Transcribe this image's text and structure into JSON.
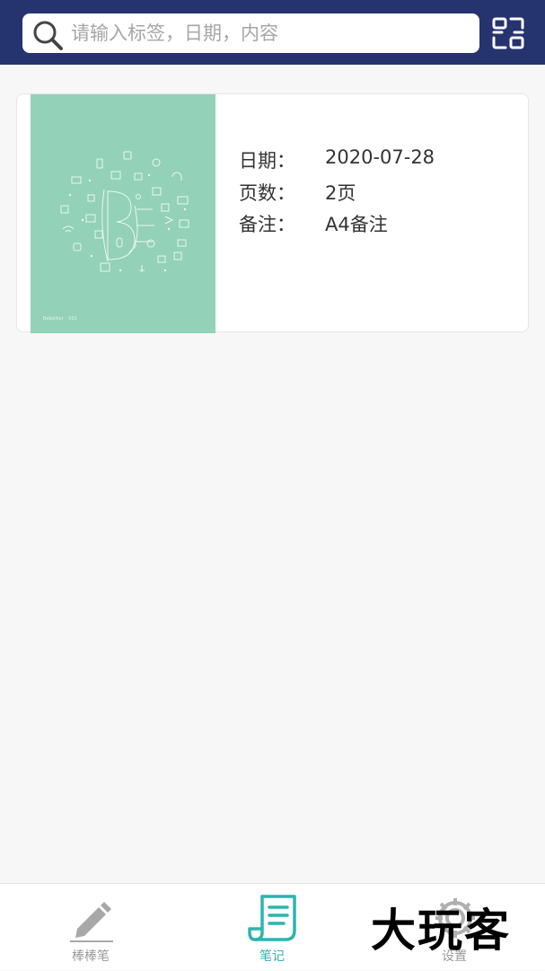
{
  "search": {
    "placeholder": "请输入标签，日期，内容",
    "value": ""
  },
  "icons": {
    "search": "search-icon",
    "scan": "scan-icon"
  },
  "note": {
    "cover_caption": "Bebeiter · 001",
    "rows": [
      {
        "label": "日期：",
        "value": "2020-07-28"
      },
      {
        "label": "页数：",
        "value": "2页"
      },
      {
        "label": "备注：",
        "value": "A4备注"
      }
    ]
  },
  "tabs": [
    {
      "label": "棒棒笔",
      "icon": "pen-icon",
      "active": false
    },
    {
      "label": "笔记",
      "icon": "notes-icon",
      "active": true
    },
    {
      "label": "设置",
      "icon": "gear-icon",
      "active": false
    }
  ],
  "watermark": "大玩客",
  "colors": {
    "header": "#25336e",
    "cover": "#93d1b8",
    "accent": "#2fb3b0",
    "inactive": "#9a9a9a",
    "background": "#f7f7f7"
  }
}
